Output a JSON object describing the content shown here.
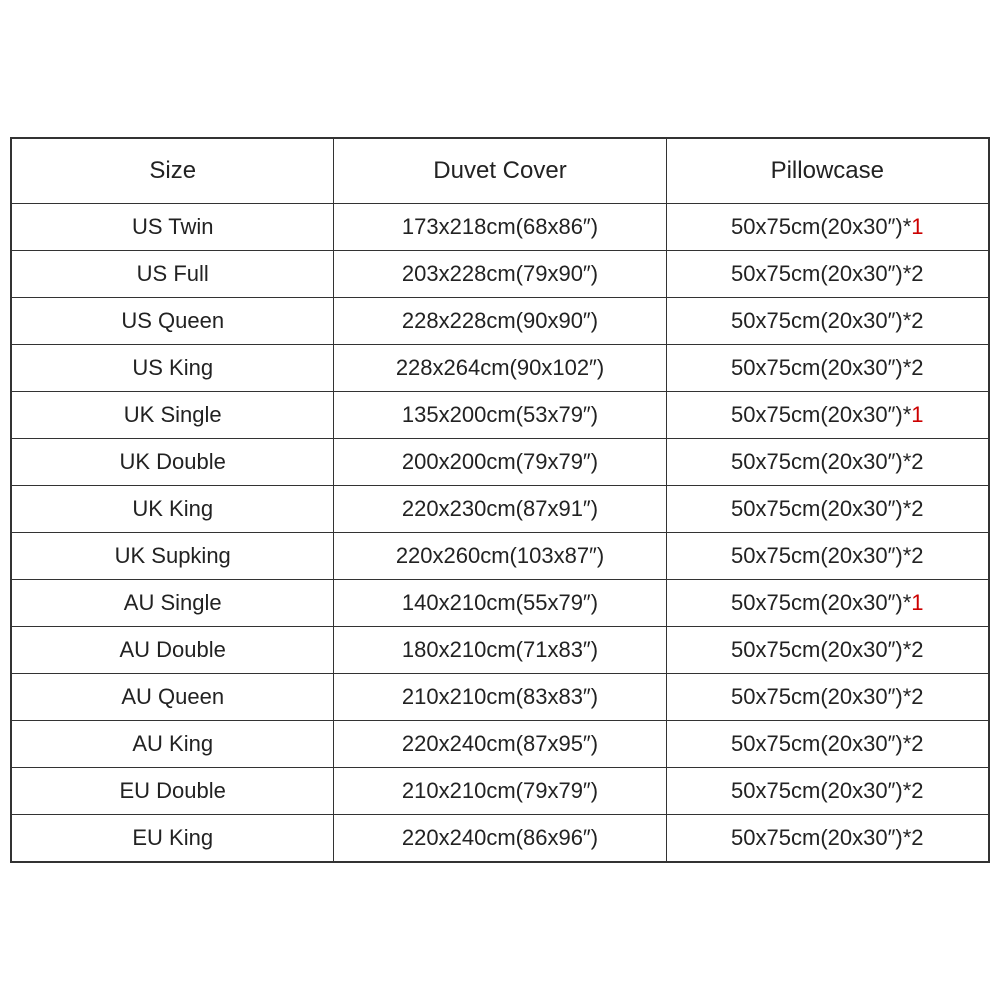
{
  "table": {
    "headers": {
      "size": "Size",
      "duvet": "Duvet Cover",
      "pillow": "Pillowcase"
    },
    "rows": [
      {
        "size": "US Twin",
        "duvet": "173x218cm(68x86″)",
        "pillow_base": "50x75cm(20x30″)*",
        "pillow_qty": "1",
        "pillow_red": true
      },
      {
        "size": "US Full",
        "duvet": "203x228cm(79x90″)",
        "pillow_base": "50x75cm(20x30″)*",
        "pillow_qty": "2",
        "pillow_red": false
      },
      {
        "size": "US Queen",
        "duvet": "228x228cm(90x90″)",
        "pillow_base": "50x75cm(20x30″)*",
        "pillow_qty": "2",
        "pillow_red": false
      },
      {
        "size": "US King",
        "duvet": "228x264cm(90x102″)",
        "pillow_base": "50x75cm(20x30″)*",
        "pillow_qty": "2",
        "pillow_red": false
      },
      {
        "size": "UK Single",
        "duvet": "135x200cm(53x79″)",
        "pillow_base": "50x75cm(20x30″)*",
        "pillow_qty": "1",
        "pillow_red": true
      },
      {
        "size": "UK Double",
        "duvet": "200x200cm(79x79″)",
        "pillow_base": "50x75cm(20x30″)*",
        "pillow_qty": "2",
        "pillow_red": false
      },
      {
        "size": "UK King",
        "duvet": "220x230cm(87x91″)",
        "pillow_base": "50x75cm(20x30″)*",
        "pillow_qty": "2",
        "pillow_red": false
      },
      {
        "size": "UK Supking",
        "duvet": "220x260cm(103x87″)",
        "pillow_base": "50x75cm(20x30″)*",
        "pillow_qty": "2",
        "pillow_red": false
      },
      {
        "size": "AU Single",
        "duvet": "140x210cm(55x79″)",
        "pillow_base": "50x75cm(20x30″)*",
        "pillow_qty": "1",
        "pillow_red": true
      },
      {
        "size": "AU Double",
        "duvet": "180x210cm(71x83″)",
        "pillow_base": "50x75cm(20x30″)*",
        "pillow_qty": "2",
        "pillow_red": false
      },
      {
        "size": "AU Queen",
        "duvet": "210x210cm(83x83″)",
        "pillow_base": "50x75cm(20x30″)*",
        "pillow_qty": "2",
        "pillow_red": false
      },
      {
        "size": "AU King",
        "duvet": "220x240cm(87x95″)",
        "pillow_base": "50x75cm(20x30″)*",
        "pillow_qty": "2",
        "pillow_red": false
      },
      {
        "size": "EU Double",
        "duvet": "210x210cm(79x79″)",
        "pillow_base": "50x75cm(20x30″)*",
        "pillow_qty": "2",
        "pillow_red": false
      },
      {
        "size": "EU King",
        "duvet": "220x240cm(86x96″)",
        "pillow_base": "50x75cm(20x30″)*",
        "pillow_qty": "2",
        "pillow_red": false
      }
    ]
  }
}
